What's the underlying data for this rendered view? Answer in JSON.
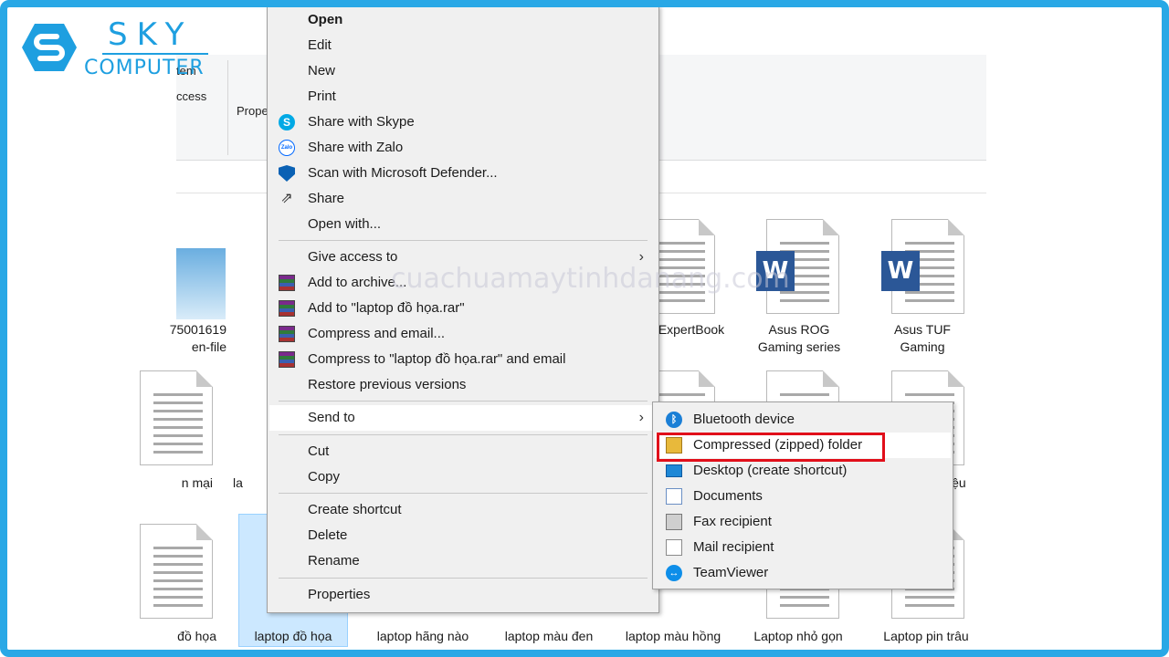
{
  "brand": {
    "line1": "SKY",
    "line2": "COMPUTER",
    "color": "#1e9fe0"
  },
  "ribbon": {
    "item_label": "tem",
    "access_label": "ccess",
    "properties_label": "Prope"
  },
  "watermark": "cuachuamaytinhdanang.com",
  "files": {
    "row1": [
      "75001619\nen-file",
      "ExpertBook",
      "Asus ROG\nGaming series",
      "Asus TUF\nGaming"
    ],
    "row2": [
      "n mại",
      "la",
      "iệu"
    ],
    "row3": [
      "đồ họa",
      "laptop đồ họa",
      "laptop hãng nào",
      "laptop màu đen",
      "laptop màu hồng",
      "Laptop nhỏ gọn",
      "Laptop pin trâu"
    ]
  },
  "context_menu": {
    "items": [
      {
        "label": "Open",
        "bold": true
      },
      {
        "label": "Edit"
      },
      {
        "label": "New"
      },
      {
        "label": "Print"
      },
      {
        "label": "Share with Skype",
        "icon": "skype-icon"
      },
      {
        "label": "Share with Zalo",
        "icon": "zalo-icon"
      },
      {
        "label": "Scan with Microsoft Defender...",
        "icon": "defender-icon"
      },
      {
        "label": "Share",
        "icon": "share-icon"
      },
      {
        "label": "Open with..."
      },
      {
        "label": "Give access to",
        "submenu": true
      },
      {
        "label": "Add to archive...",
        "icon": "winrar-icon"
      },
      {
        "label": "Add to \"laptop đồ họa.rar\"",
        "icon": "winrar-icon"
      },
      {
        "label": "Compress and email...",
        "icon": "winrar-icon"
      },
      {
        "label": "Compress to \"laptop đồ họa.rar\" and email",
        "icon": "winrar-icon"
      },
      {
        "label": "Restore previous versions"
      },
      {
        "label": "Send to",
        "submenu": true,
        "active": true
      },
      {
        "label": "Cut"
      },
      {
        "label": "Copy"
      },
      {
        "label": "Create shortcut"
      },
      {
        "label": "Delete"
      },
      {
        "label": "Rename"
      },
      {
        "label": "Properties"
      }
    ],
    "arrow": "›"
  },
  "send_to_menu": {
    "items": [
      {
        "label": "Bluetooth device",
        "icon": "bluetooth-icon"
      },
      {
        "label": "Compressed (zipped) folder",
        "icon": "zip-folder-icon",
        "highlighted": true
      },
      {
        "label": "Desktop (create shortcut)",
        "icon": "desktop-icon"
      },
      {
        "label": "Documents",
        "icon": "documents-icon"
      },
      {
        "label": "Fax recipient",
        "icon": "fax-icon"
      },
      {
        "label": "Mail recipient",
        "icon": "mail-icon"
      },
      {
        "label": "TeamViewer",
        "icon": "teamviewer-icon"
      }
    ],
    "highlight_color": "#e10f1a"
  },
  "word_badge": "W"
}
